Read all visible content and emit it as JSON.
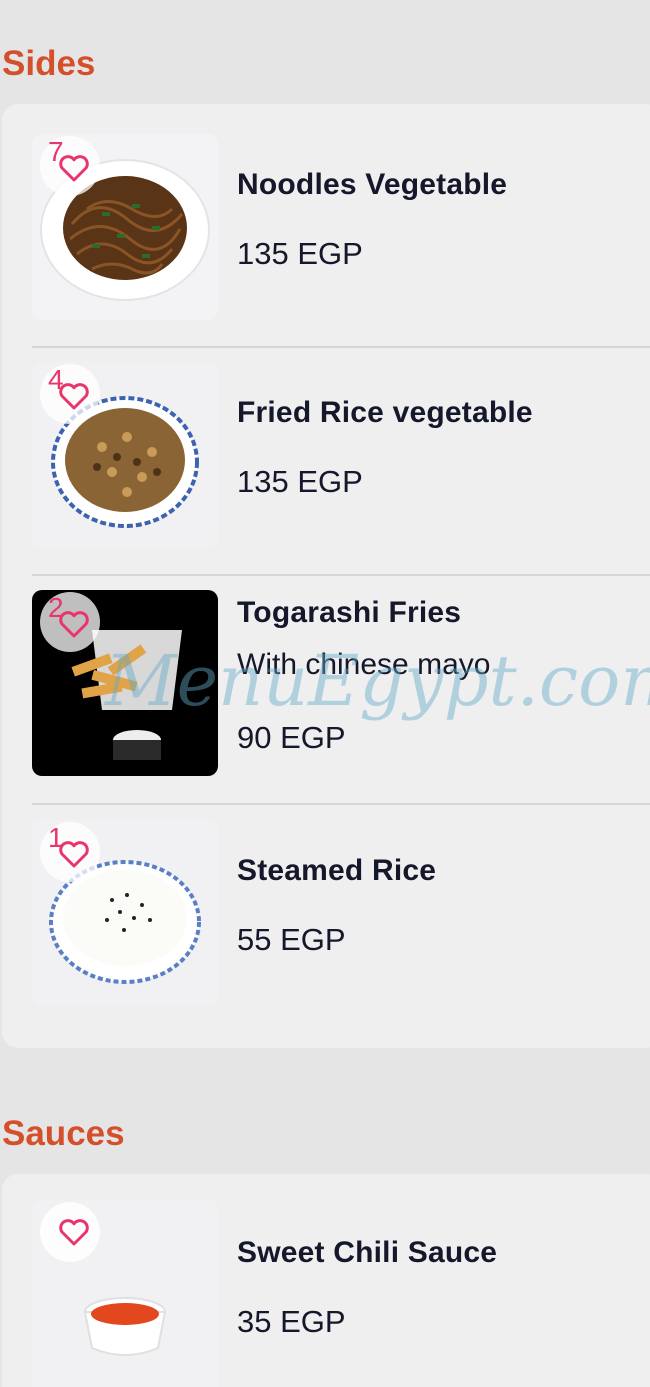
{
  "sections": [
    {
      "title": "Sides",
      "items": [
        {
          "name": "Noodles Vegetable",
          "desc": "",
          "price": "135 EGP",
          "favorites": "7",
          "icon": "heart-outline-icon"
        },
        {
          "name": "Fried Rice vegetable",
          "desc": "",
          "price": "135 EGP",
          "favorites": "4",
          "icon": "heart-outline-icon"
        },
        {
          "name": "Togarashi Fries",
          "desc": "With chinese mayo",
          "price": "90 EGP",
          "favorites": "2",
          "icon": "heart-outline-icon"
        },
        {
          "name": "Steamed Rice",
          "desc": "",
          "price": "55 EGP",
          "favorites": "1",
          "icon": "heart-outline-icon"
        }
      ]
    },
    {
      "title": "Sauces",
      "items": [
        {
          "name": "Sweet Chili Sauce",
          "desc": "",
          "price": "35 EGP",
          "favorites": "",
          "icon": "heart-outline-icon"
        }
      ]
    }
  ],
  "watermark": "MenuEgypt.com",
  "colors": {
    "background": "#e6e5e6",
    "card": "#efeff0",
    "section_title": "#d4502a",
    "text": "#15172a",
    "accent_pink": "#e8356c"
  }
}
